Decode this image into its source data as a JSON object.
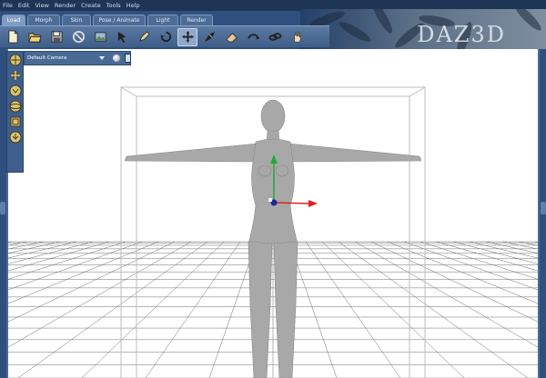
{
  "menubar": {
    "items": [
      "File",
      "Edit",
      "View",
      "Render",
      "Create",
      "Tools",
      "Help"
    ]
  },
  "tabs": [
    {
      "label": "Load",
      "active": true
    },
    {
      "label": "Morph",
      "active": false
    },
    {
      "label": "Skin",
      "active": false
    },
    {
      "label": "Pose / Animate",
      "active": false
    },
    {
      "label": "Light",
      "active": false
    },
    {
      "label": "Render",
      "active": false
    }
  ],
  "toolbar": {
    "icons": [
      "new-icon",
      "open-icon",
      "save-icon",
      "no-entry-icon",
      "scene-icon",
      "select-arrow-icon",
      "pen-tool-icon",
      "rotate-icon",
      "move-icon",
      "camera-arrow-icon",
      "eraser-icon",
      "twist-icon",
      "chain-link-icon",
      "hand-icon"
    ],
    "selected_index": 8
  },
  "viewport": {
    "camera_label": "Default Camera",
    "camera_controls": [
      "pan-icon",
      "move-xy-icon",
      "move-z-icon",
      "orbit-icon",
      "frame-icon",
      "zoom-icon"
    ]
  },
  "colors": {
    "accent": "#3e5f8c",
    "grid": "#6f6f6f",
    "gizmo_y": "#22aa33",
    "gizmo_x": "#dd2222",
    "gizmo_center": "#1a2a9a",
    "figure": "#a9a9a9"
  }
}
